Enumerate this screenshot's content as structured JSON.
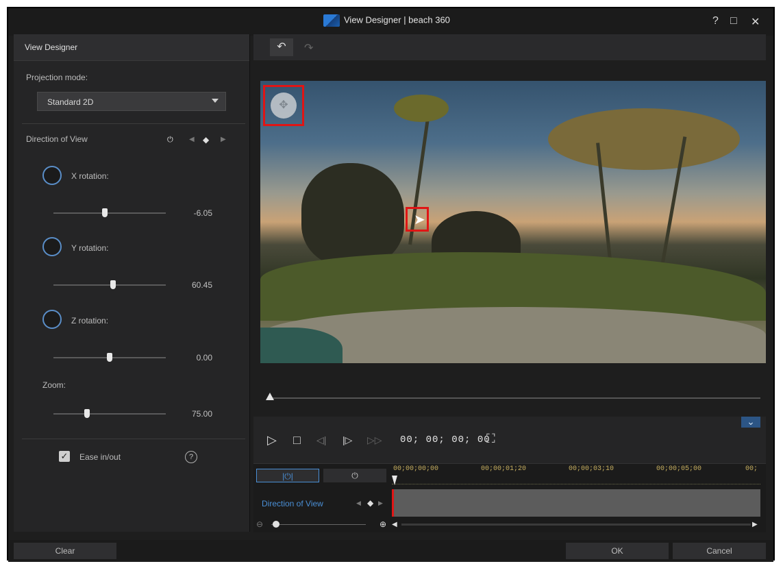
{
  "window": {
    "title": "View Designer | beach 360",
    "help_label": "?",
    "maximize_label": "□",
    "close_label": "✕"
  },
  "left_panel": {
    "header": "View Designer",
    "projection_label": "Projection mode:",
    "projection_value": "Standard 2D",
    "direction_label": "Direction of View",
    "x_rotation": {
      "label": "X rotation:",
      "value": "-6.05",
      "slider_fraction": 0.46
    },
    "y_rotation": {
      "label": "Y rotation:",
      "value": "60.45",
      "slider_fraction": 0.53
    },
    "z_rotation": {
      "label": "Z rotation:",
      "value": "0.00",
      "slider_fraction": 0.5
    },
    "zoom": {
      "label": "Zoom:",
      "value": "75.00",
      "slider_fraction": 0.3
    },
    "ease_label": "Ease in/out",
    "ease_checked": true,
    "help_glyph": "?"
  },
  "toolbar": {
    "undo_glyph": "↶",
    "redo_glyph": "↷"
  },
  "player": {
    "timecode": "00; 00; 00; 00",
    "play_glyph": "▷",
    "stop_glyph": "□",
    "prev_glyph": "◁|",
    "next_glyph": "|▷",
    "end_glyph": "▷▷",
    "fullscreen_glyph": "⛶",
    "expand_glyph": "⌄"
  },
  "timeline": {
    "ruler": [
      "00;00;00;00",
      "00;00;01;20",
      "00;00;03;10",
      "00;00;05;00",
      "00;"
    ],
    "track_label": "Direction of View"
  },
  "buttons": {
    "clear": "Clear",
    "ok": "OK",
    "cancel": "Cancel"
  },
  "colors": {
    "accent": "#5a8ec8",
    "highlight": "#e01515",
    "track_label": "#4a8fd6"
  }
}
